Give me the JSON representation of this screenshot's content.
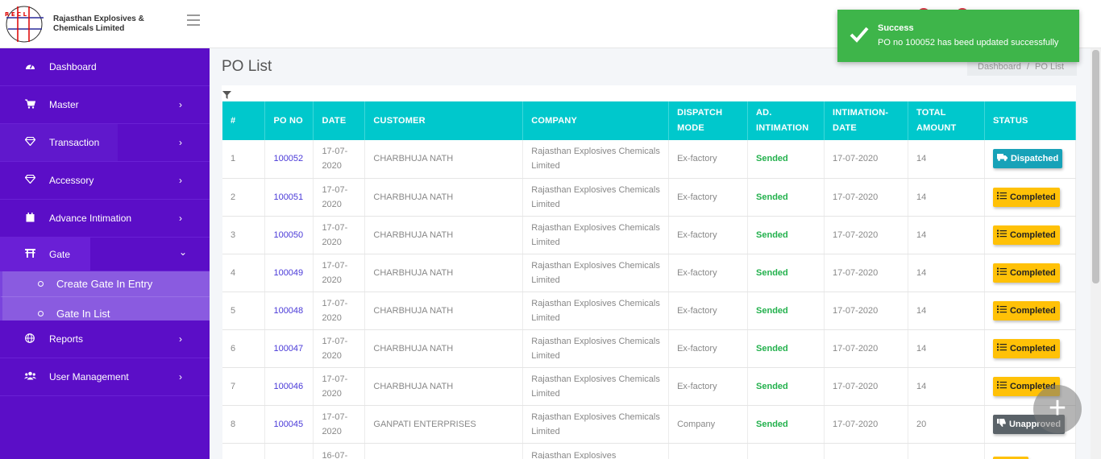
{
  "brand": {
    "line1": "Rajasthan Explosives &",
    "line2": "Chemicals Limited"
  },
  "sidebar": {
    "items": [
      {
        "label": "Dashboard",
        "icon": "dashboard-icon"
      },
      {
        "label": "Master",
        "icon": "cart-icon"
      },
      {
        "label": "Transaction",
        "icon": "diamond-icon"
      },
      {
        "label": "Accessory",
        "icon": "diamond-icon"
      },
      {
        "label": "Advance Intimation",
        "icon": "calendar-icon"
      },
      {
        "label": "Gate",
        "icon": "gate-icon"
      },
      {
        "label": "Reports",
        "icon": "globe-icon"
      },
      {
        "label": "User Management",
        "icon": "users-icon"
      }
    ],
    "gate_sub": [
      "Create Gate In Entry",
      "Gate In List"
    ]
  },
  "page": {
    "title": "PO List"
  },
  "breadcrumb": {
    "home": "Dashboard",
    "sep": "/",
    "current": "PO List"
  },
  "toast": {
    "title": "Success",
    "message": "PO no 100052 has beed updated successfully",
    "color": "#3eb54a"
  },
  "table": {
    "headers": [
      "#",
      "PO NO",
      "DATE",
      "CUSTOMER",
      "COMPANY",
      "DISPATCH MODE",
      "AD. INTIMATION",
      "INTIMATION-DATE",
      "TOTAL AMOUNT",
      "STATUS"
    ],
    "rows": [
      {
        "n": "1",
        "po": "100052",
        "date": "17-07-2020",
        "customer": "CHARBHUJA NATH",
        "company": "Rajasthan Explosives Chemicals Limited",
        "mode": "Ex-factory",
        "intimation": "Sended",
        "idate": "17-07-2020",
        "amount": "14",
        "status": "Dispatched"
      },
      {
        "n": "2",
        "po": "100051",
        "date": "17-07-2020",
        "customer": "CHARBHUJA NATH",
        "company": "Rajasthan Explosives Chemicals Limited",
        "mode": "Ex-factory",
        "intimation": "Sended",
        "idate": "17-07-2020",
        "amount": "14",
        "status": "Completed"
      },
      {
        "n": "3",
        "po": "100050",
        "date": "17-07-2020",
        "customer": "CHARBHUJA NATH",
        "company": "Rajasthan Explosives Chemicals Limited",
        "mode": "Ex-factory",
        "intimation": "Sended",
        "idate": "17-07-2020",
        "amount": "14",
        "status": "Completed"
      },
      {
        "n": "4",
        "po": "100049",
        "date": "17-07-2020",
        "customer": "CHARBHUJA NATH",
        "company": "Rajasthan Explosives Chemicals Limited",
        "mode": "Ex-factory",
        "intimation": "Sended",
        "idate": "17-07-2020",
        "amount": "14",
        "status": "Completed"
      },
      {
        "n": "5",
        "po": "100048",
        "date": "17-07-2020",
        "customer": "CHARBHUJA NATH",
        "company": "Rajasthan Explosives Chemicals Limited",
        "mode": "Ex-factory",
        "intimation": "Sended",
        "idate": "17-07-2020",
        "amount": "14",
        "status": "Completed"
      },
      {
        "n": "6",
        "po": "100047",
        "date": "17-07-2020",
        "customer": "CHARBHUJA NATH",
        "company": "Rajasthan Explosives Chemicals Limited",
        "mode": "Ex-factory",
        "intimation": "Sended",
        "idate": "17-07-2020",
        "amount": "14",
        "status": "Completed"
      },
      {
        "n": "7",
        "po": "100046",
        "date": "17-07-2020",
        "customer": "CHARBHUJA NATH",
        "company": "Rajasthan Explosives Chemicals Limited",
        "mode": "Ex-factory",
        "intimation": "Sended",
        "idate": "17-07-2020",
        "amount": "14",
        "status": "Completed"
      },
      {
        "n": "8",
        "po": "100045",
        "date": "17-07-2020",
        "customer": "GANPATI ENTERPRISES",
        "company": "Rajasthan Explosives Chemicals Limited",
        "mode": "Company",
        "intimation": "Sended",
        "idate": "17-07-2020",
        "amount": "20",
        "status": "Unapproved"
      },
      {
        "n": "",
        "po": "",
        "date": "16-07-",
        "customer": "",
        "company": "Rajasthan Explosives",
        "mode": "",
        "intimation": "",
        "idate": "",
        "amount": "",
        "status": ""
      }
    ]
  },
  "colors": {
    "sidebar": "#5b0ec7",
    "table_header": "#00c8cc",
    "dispatched": "#17a2b8",
    "completed": "#ffc107",
    "unapproved": "#5a6268",
    "sended": "#23b14d"
  }
}
